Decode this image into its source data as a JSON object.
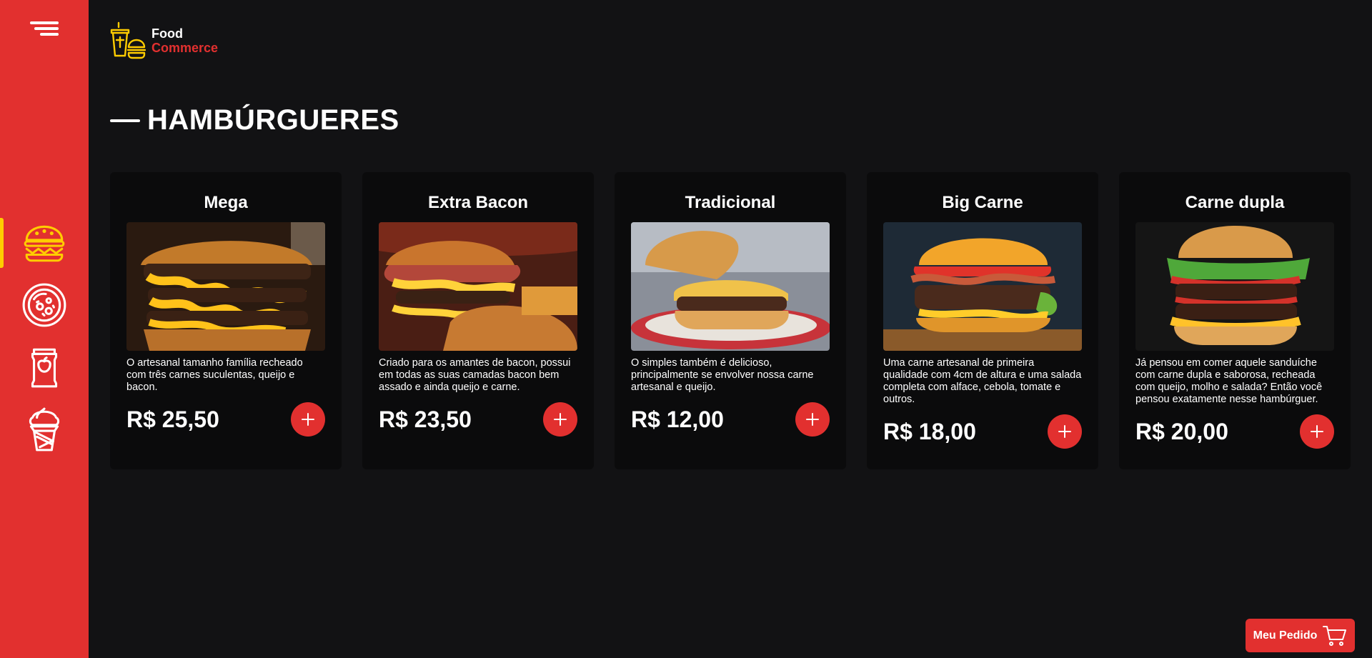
{
  "colors": {
    "background": "#121214",
    "sidebar": "#e2302f",
    "card": "#0b0b0c",
    "accent_red": "#e2302f",
    "accent_yellow": "#ffcc00",
    "text": "#ffffff"
  },
  "sidebar": {
    "menu_icon": "hamburger-menu-icon",
    "items": [
      {
        "icon": "burger-icon",
        "active": true
      },
      {
        "icon": "pizza-icon",
        "active": false
      },
      {
        "icon": "drink-can-icon",
        "active": false
      },
      {
        "icon": "ice-cream-icon",
        "active": false
      }
    ]
  },
  "header": {
    "logo_line1": "Food",
    "logo_line2": "Commerce"
  },
  "section": {
    "title": "HAMBÚRGUERES"
  },
  "products": [
    {
      "name": "Mega",
      "description": "O artesanal tamanho família recheado com três carnes suculentas, queijo e bacon.",
      "price": "R$ 25,50"
    },
    {
      "name": "Extra Bacon",
      "description": "Criado para os amantes de bacon, possui em todas as suas camadas bacon bem assado e ainda queijo e carne.",
      "price": "R$ 23,50"
    },
    {
      "name": "Tradicional",
      "description": "O simples também é delicioso, principalmente se envolver nossa carne artesanal e queijo.",
      "price": "R$ 12,00"
    },
    {
      "name": "Big Carne",
      "description": "Uma carne artesanal de primeira qualidade com 4cm de altura e uma salada completa com alface, cebola, tomate e outros.",
      "price": "R$ 18,00"
    },
    {
      "name": "Carne dupla",
      "description": "Já pensou em comer aquele sanduíche com carne dupla e saborosa, recheada com queijo, molho e salada? Então você pensou exatamente nesse hambúrguer.",
      "price": "R$ 20,00"
    }
  ],
  "order_button": {
    "label": "Meu Pedido",
    "icon": "cart-icon"
  }
}
